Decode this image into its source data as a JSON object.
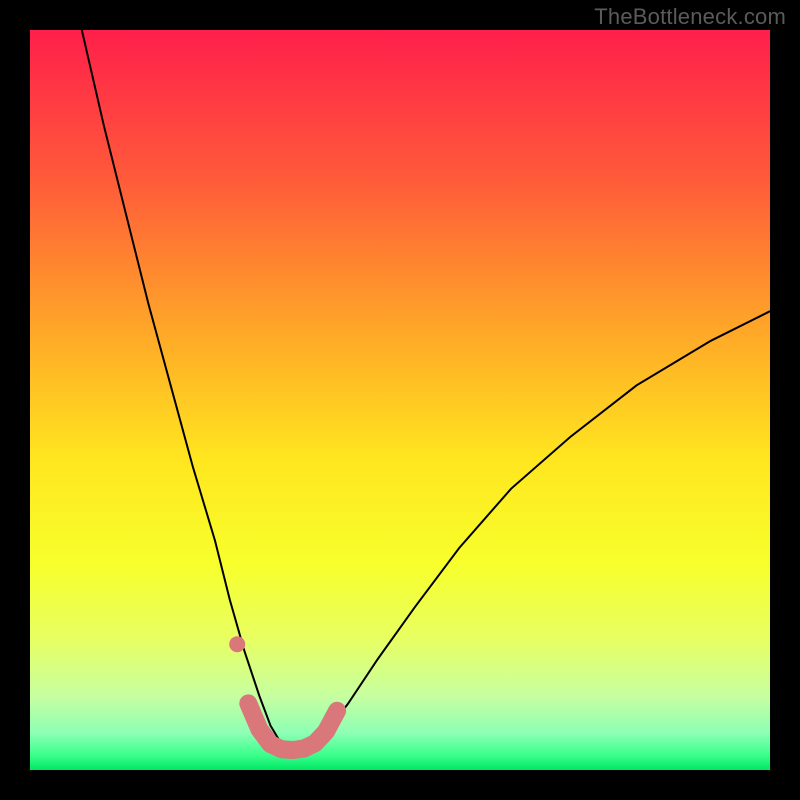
{
  "watermark": {
    "text": "TheBottleneck.com"
  },
  "chart_data": {
    "type": "line",
    "title": "",
    "xlabel": "",
    "ylabel": "",
    "xlim": [
      0,
      100
    ],
    "ylim": [
      0,
      100
    ],
    "grid": false,
    "legend": false,
    "background_gradient_stops": [
      {
        "offset": 0.0,
        "color": "#ff1f4b"
      },
      {
        "offset": 0.2,
        "color": "#ff5a3a"
      },
      {
        "offset": 0.4,
        "color": "#ffa528"
      },
      {
        "offset": 0.58,
        "color": "#ffe61f"
      },
      {
        "offset": 0.72,
        "color": "#f7ff2b"
      },
      {
        "offset": 0.82,
        "color": "#e8ff60"
      },
      {
        "offset": 0.9,
        "color": "#c7ffa0"
      },
      {
        "offset": 0.95,
        "color": "#8dffb5"
      },
      {
        "offset": 0.98,
        "color": "#3bff8c"
      },
      {
        "offset": 1.0,
        "color": "#00e765"
      }
    ],
    "series": [
      {
        "name": "bottleneck-curve",
        "color": "#000000",
        "stroke_width": 2,
        "x": [
          7,
          10,
          13,
          16,
          19,
          22,
          25,
          27,
          29,
          31,
          32.5,
          34,
          35,
          36,
          38,
          40,
          43,
          47,
          52,
          58,
          65,
          73,
          82,
          92,
          100
        ],
        "y": [
          100,
          87,
          75,
          63,
          52,
          41,
          31,
          23,
          16,
          10,
          6,
          3.5,
          2.5,
          2.5,
          3,
          5,
          9,
          15,
          22,
          30,
          38,
          45,
          52,
          58,
          62
        ]
      },
      {
        "name": "highlight-trough",
        "color": "#d9777a",
        "stroke_width": 18,
        "linecap": "round",
        "x": [
          29.5,
          31,
          32.5,
          34,
          35.5,
          37,
          38.5,
          40,
          41.5
        ],
        "y": [
          9,
          5.5,
          3.5,
          2.8,
          2.7,
          2.9,
          3.6,
          5.2,
          8
        ]
      }
    ],
    "points": [
      {
        "name": "highlight-dot",
        "x": 28,
        "y": 17,
        "r": 8,
        "color": "#d9777a"
      }
    ]
  }
}
